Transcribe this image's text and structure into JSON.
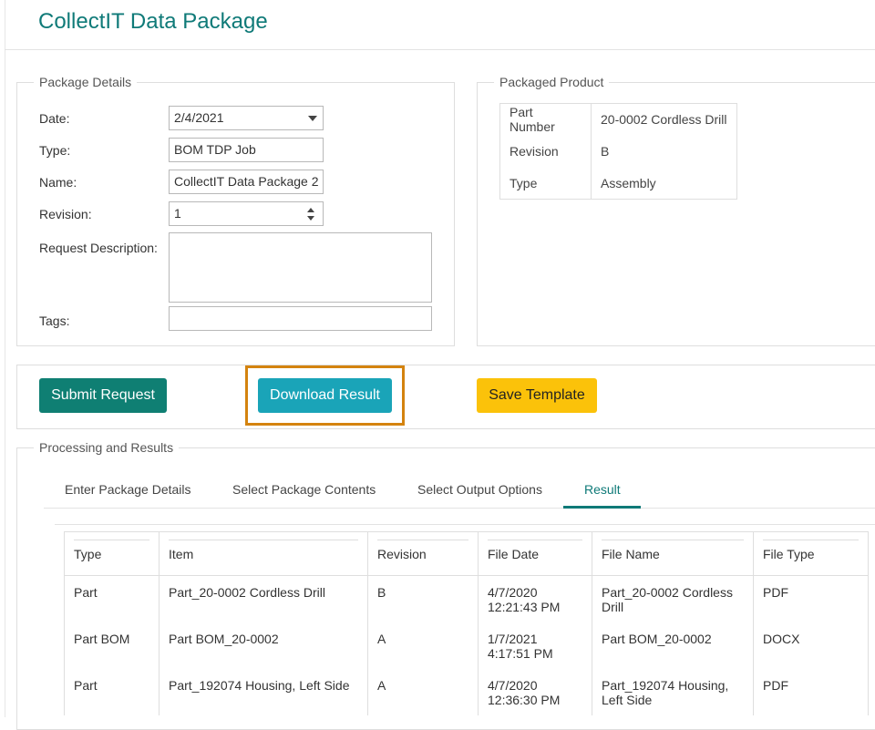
{
  "page": {
    "title": "CollectIT Data Package"
  },
  "package_details": {
    "legend": "Package Details",
    "date_label": "Date:",
    "date_value": "2/4/2021",
    "type_label": "Type:",
    "type_value": "BOM TDP Job",
    "name_label": "Name:",
    "name_value": "CollectIT Data Package 2",
    "revision_label": "Revision:",
    "revision_value": "1",
    "description_label": "Request Description:",
    "description_value": "",
    "tags_label": "Tags:",
    "tags_value": ""
  },
  "packaged_product": {
    "legend": "Packaged Product",
    "rows": [
      {
        "key": "Part Number",
        "value": "20-0002 Cordless Drill"
      },
      {
        "key": "Revision",
        "value": "B"
      },
      {
        "key": "Type",
        "value": "Assembly"
      }
    ]
  },
  "actions": {
    "submit_label": "Submit Request",
    "download_label": "Download Result",
    "save_label": "Save Template"
  },
  "processing": {
    "legend": "Processing and Results",
    "tabs": [
      {
        "label": "Enter Package Details"
      },
      {
        "label": "Select Package Contents"
      },
      {
        "label": "Select Output Options"
      },
      {
        "label": "Result",
        "active": true
      }
    ],
    "columns": [
      "Type",
      "Item",
      "Revision",
      "File Date",
      "File Name",
      "File Type"
    ],
    "rows": [
      {
        "type": "Part",
        "item": "Part_20-0002 Cordless Drill",
        "revision": "B",
        "file_date_1": "4/7/2020",
        "file_date_2": "12:21:43 PM",
        "file_name_1": "Part_20-0002 Cordless",
        "file_name_2": "Drill",
        "file_type": "PDF"
      },
      {
        "type": "Part BOM",
        "item": "Part BOM_20-0002",
        "revision": "A",
        "file_date_1": "1/7/2021",
        "file_date_2": "4:17:51 PM",
        "file_name_1": "Part BOM_20-0002",
        "file_name_2": "",
        "file_type": "DOCX"
      },
      {
        "type": "Part",
        "item": "Part_192074 Housing, Left Side",
        "revision": "A",
        "file_date_1": "4/7/2020",
        "file_date_2": "12:36:30 PM",
        "file_name_1": "Part_192074 Housing,",
        "file_name_2": "Left Side",
        "file_type": "PDF"
      }
    ]
  },
  "colors": {
    "accent": "#0f7a78",
    "submit": "#0f7f73",
    "download": "#1aa4b8",
    "save": "#fbc20a",
    "highlight": "#d4830f"
  }
}
